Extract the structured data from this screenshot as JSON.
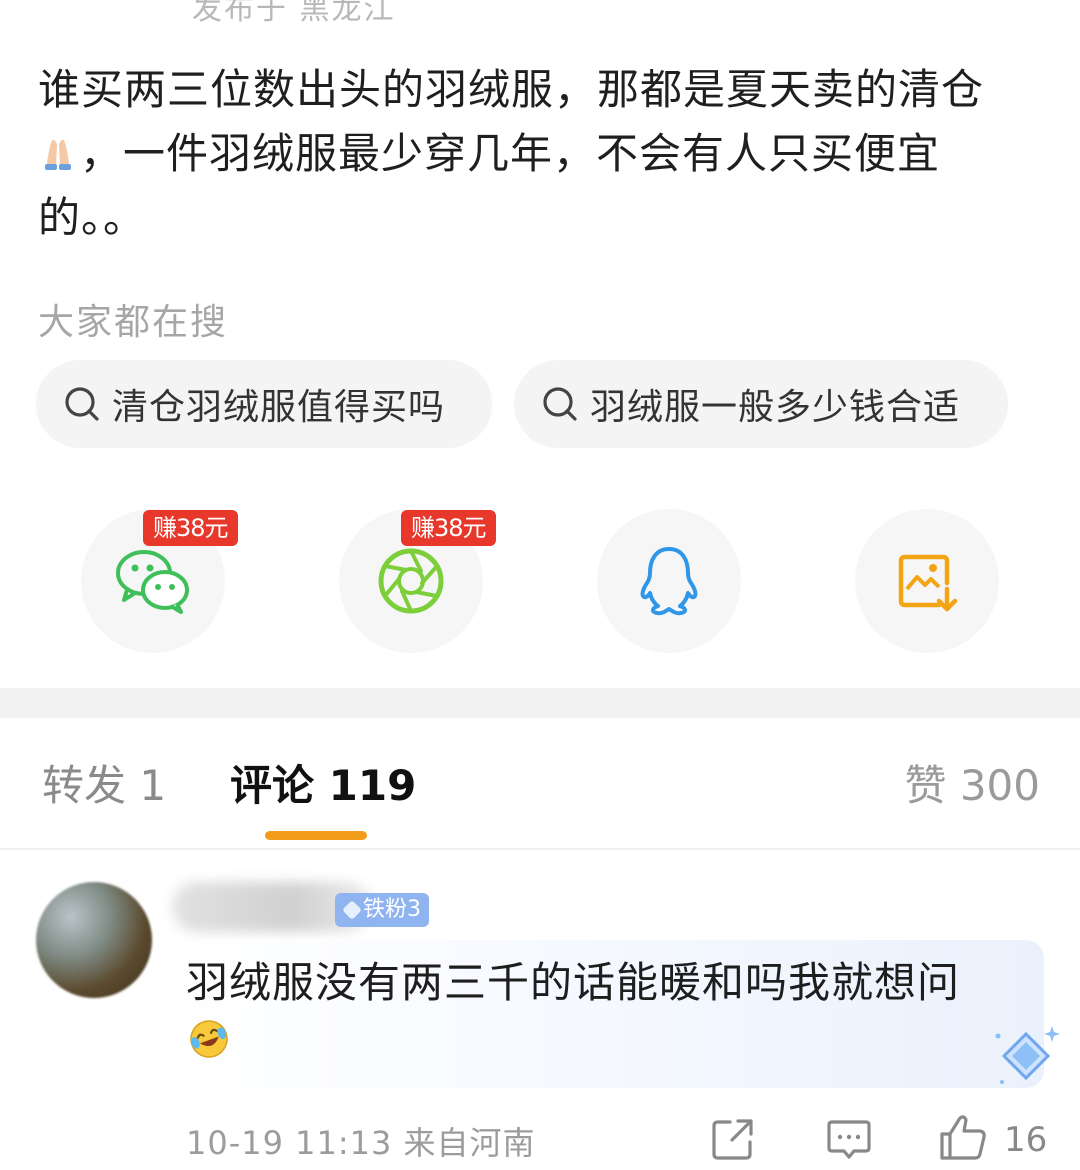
{
  "post": {
    "location": "发布于 黑龙江",
    "text_part1": "谁买两三位数出头的羽绒服，那都是夏天卖的清仓",
    "text_part2": "，一件羽绒服最少穿几年，不会有人只买便宜的。。"
  },
  "search": {
    "label": "大家都在搜",
    "chips": [
      {
        "text": "清仓羽绒服值得买吗",
        "icon": "search-icon"
      },
      {
        "text": "羽绒服一般多少钱合适",
        "icon": "search-icon"
      }
    ]
  },
  "share": {
    "items": [
      {
        "icon": "wechat-icon",
        "badge": "赚38元",
        "color": "#3fbf5a"
      },
      {
        "icon": "moments-icon",
        "badge": "赚38元",
        "color": "#7ccf3a"
      },
      {
        "icon": "qq-icon",
        "color": "#2f96e8"
      },
      {
        "icon": "save-image-icon",
        "color": "#f2a414"
      }
    ]
  },
  "tabs": {
    "repost": "转发 1",
    "comment": "评论 119",
    "like": "赞 300",
    "active_color": "#f39b1b"
  },
  "comment": {
    "fan_badge": "铁粉3",
    "text": "羽绒服没有两三千的话能暖和吗我就想问",
    "emoji": "laugh-cry-icon",
    "meta": "10-19 11:13 来自河南",
    "like_count": "16"
  }
}
